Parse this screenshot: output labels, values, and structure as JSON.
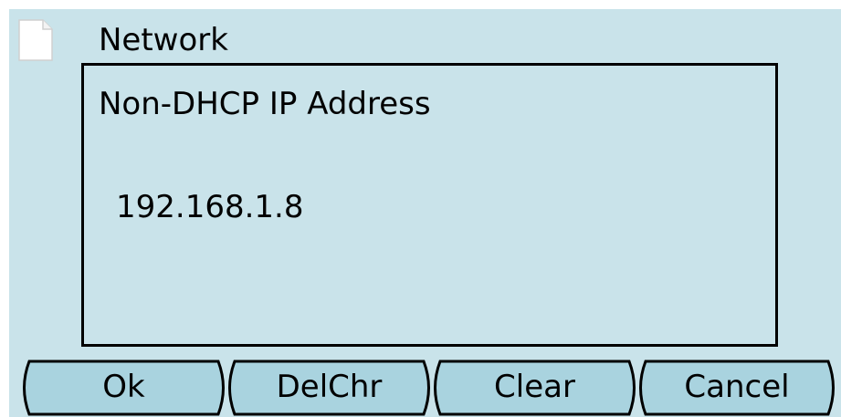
{
  "header": {
    "title": "Network",
    "icon": "document-icon"
  },
  "field": {
    "label": "Non-DHCP IP Address",
    "value": "192.168.1.8"
  },
  "softkeys": [
    {
      "label": "Ok"
    },
    {
      "label": "DelChr"
    },
    {
      "label": "Clear"
    },
    {
      "label": "Cancel"
    }
  ],
  "colors": {
    "background": "#c9e3ea",
    "softkey_fill": "#a9d3df",
    "border": "#000000",
    "text": "#000000"
  }
}
